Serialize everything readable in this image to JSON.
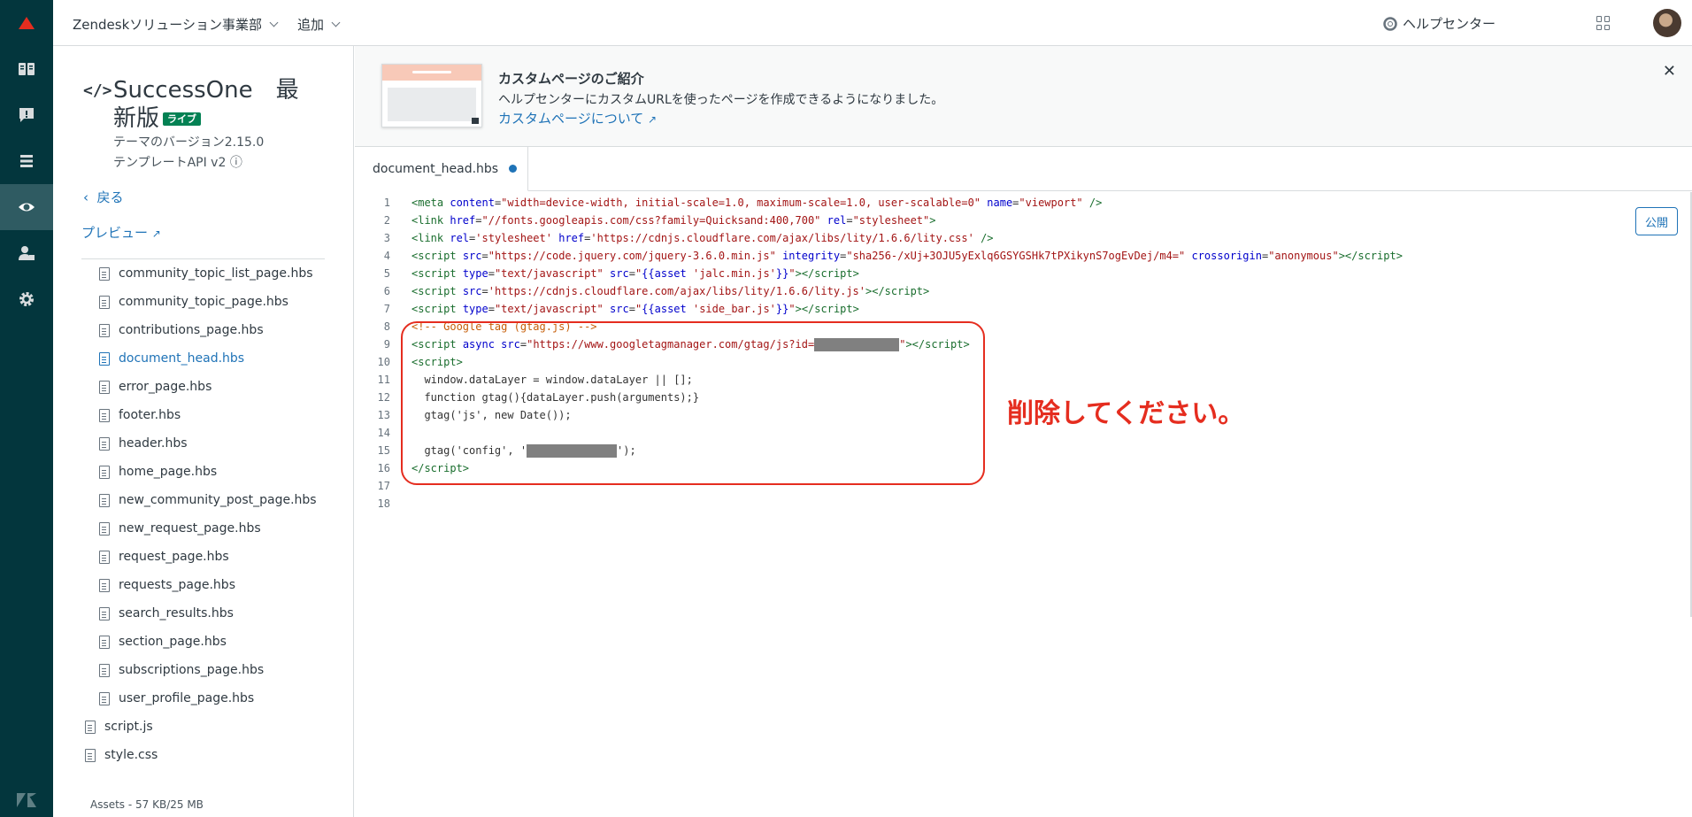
{
  "rail": {
    "icons": [
      "zendesk-logo-icon",
      "guide-icon",
      "feedback-icon",
      "arrange-icon",
      "view-icon",
      "user-permissions-icon",
      "settings-icon"
    ]
  },
  "topbar": {
    "brand": "Zendeskソリューション事業部",
    "add": "追加",
    "help_center": "ヘルプセンター"
  },
  "sidebar": {
    "theme_name": "SuccessOne　最新版",
    "live_badge": "ライブ",
    "version": "テーマのバージョン2.15.0",
    "api": "テンプレートAPI v2 ⓘ",
    "back": "戻る",
    "preview": "プレビュー",
    "files": [
      "community_topic_list_page.hbs",
      "community_topic_page.hbs",
      "contributions_page.hbs",
      "document_head.hbs",
      "error_page.hbs",
      "footer.hbs",
      "header.hbs",
      "home_page.hbs",
      "new_community_post_page.hbs",
      "new_request_page.hbs",
      "request_page.hbs",
      "requests_page.hbs",
      "search_results.hbs",
      "section_page.hbs",
      "subscriptions_page.hbs",
      "user_profile_page.hbs"
    ],
    "root_files": [
      "script.js",
      "style.css"
    ],
    "active_file": "document_head.hbs",
    "assets": "Assets - 57 KB/25 MB"
  },
  "banner": {
    "title": "カスタムページのご紹介",
    "text": "ヘルプセンターにカスタムURLを使ったページを作成できるようになりました。",
    "link": "カスタムページについて"
  },
  "editor": {
    "tab": "document_head.hbs",
    "publish": "公開",
    "annotation": "削除してください。",
    "line_numbers": [
      "1",
      "2",
      "3",
      "4",
      "5",
      "6",
      "7",
      "8",
      "9",
      "10",
      "11",
      "12",
      "13",
      "14",
      "15",
      "16",
      "17",
      "18"
    ]
  },
  "colors": {
    "rail": "#03363d",
    "accent": "#1f73b7",
    "annotation": "#e52d1f",
    "live": "#038153"
  }
}
